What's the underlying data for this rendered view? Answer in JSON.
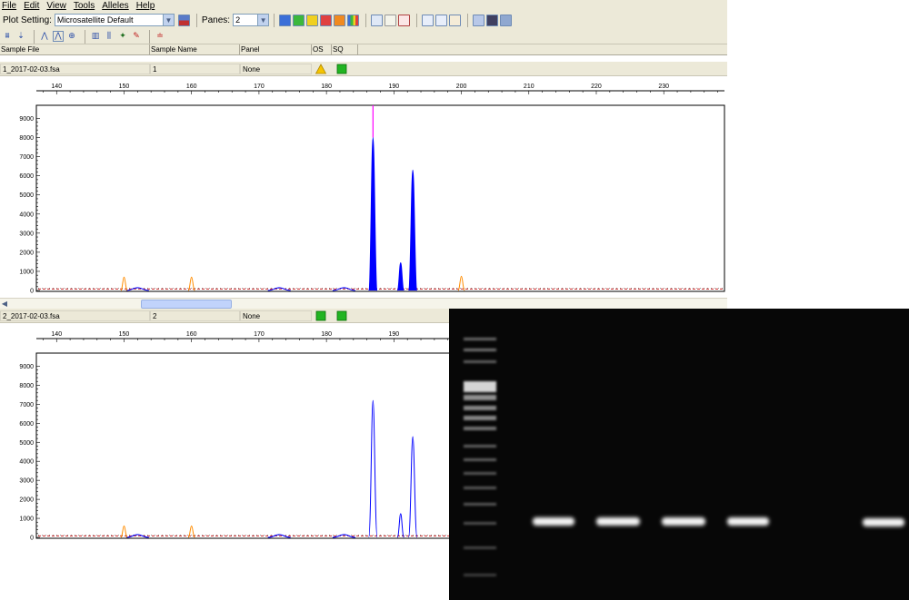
{
  "menu": [
    "File",
    "Edit",
    "View",
    "Tools",
    "Alleles",
    "Help"
  ],
  "toolbar": {
    "plot_setting_label": "Plot Setting:",
    "plot_setting_value": "Microsatellite Default",
    "panes_label": "Panes:",
    "panes_value": "2"
  },
  "columns": {
    "sample_file": "Sample File",
    "sample_name": "Sample Name",
    "panel": "Panel",
    "os": "OS",
    "sq": "SQ"
  },
  "samples": [
    {
      "file": "1_2017-02-03.fsa",
      "name": "1",
      "panel": "None",
      "os_status": "warning",
      "sq_status": "pass"
    },
    {
      "file": "2_2017-02-03.fsa",
      "name": "2",
      "panel": "None",
      "os_status": "pass",
      "sq_status": "pass"
    }
  ],
  "axis": {
    "x_ticks": [
      "140",
      "150",
      "160",
      "170",
      "180",
      "190",
      "200",
      "210",
      "220",
      "230"
    ],
    "y_ticks": [
      "9000",
      "8000",
      "7000",
      "6000",
      "5000",
      "4000",
      "3000",
      "2000",
      "1000",
      "0"
    ]
  },
  "colors": {
    "blue_dye": "#0000ff",
    "size_standard": "#ff8c00",
    "cursor": "#ff00ff",
    "window_bg": "#ece9d8",
    "status_warning": "#f5c400",
    "status_pass": "#22b422"
  },
  "chart_data": [
    {
      "type": "line",
      "xlabel": "",
      "ylabel": "",
      "xlim": [
        137,
        239
      ],
      "ylim": [
        0,
        9500
      ],
      "grid": false,
      "filled": true,
      "series": [
        {
          "color": "#0000ff",
          "x": [
            152,
            173,
            182.6,
            186.9,
            191.0,
            192.8
          ],
          "y": [
            150,
            150,
            150,
            8000,
            1450,
            6300
          ]
        },
        {
          "color": "#ff8c00",
          "x": [
            150,
            160,
            200
          ],
          "y": [
            700,
            700,
            750
          ]
        }
      ],
      "cursor_x": 186.9
    },
    {
      "type": "line",
      "xlabel": "",
      "ylabel": "",
      "xlim": [
        137,
        239
      ],
      "ylim": [
        0,
        9500
      ],
      "grid": false,
      "filled": false,
      "series": [
        {
          "color": "#0000ff",
          "x": [
            152,
            173,
            182.6,
            186.9,
            191.0,
            192.8
          ],
          "y": [
            150,
            150,
            150,
            7200,
            1250,
            5300
          ]
        },
        {
          "color": "#ff8c00",
          "x": [
            150,
            160
          ],
          "y": [
            600,
            600
          ]
        }
      ]
    }
  ]
}
